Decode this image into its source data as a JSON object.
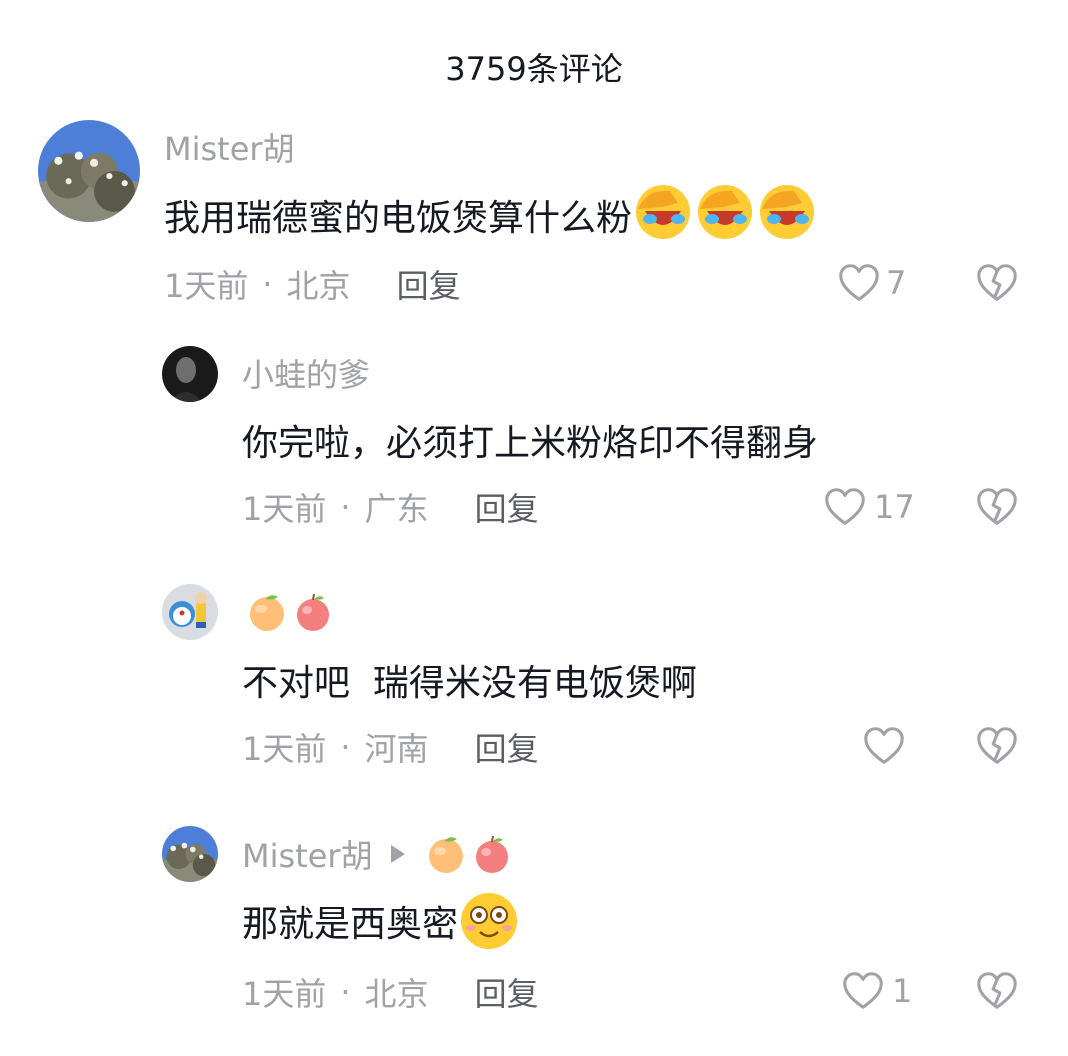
{
  "header": {
    "title": "3759条评论"
  },
  "comments": [
    {
      "name": "Mister胡",
      "text": "我用瑞德蜜的电饭煲算什么粉",
      "emoji": "facepalm-laugh-emoji",
      "time": "1天前",
      "location": "北京",
      "reply": "回复",
      "likes": "7"
    },
    {
      "name": "小蛙的爹",
      "text": "你完啦，必须打上米粉烙印不得翻身",
      "time": "1天前",
      "location": "广东",
      "reply": "回复",
      "likes": "17"
    },
    {
      "name": "",
      "name_emoji": [
        "peach-emoji",
        "apple-emoji"
      ],
      "text": "不对吧  瑞得米没有电饭煲啊",
      "time": "1天前",
      "location": "河南",
      "reply": "回复",
      "likes": ""
    },
    {
      "name": "Mister胡",
      "name_emoji": [
        "peach-emoji",
        "apple-emoji"
      ],
      "text": "那就是西奥密",
      "emoji": "dazed-smile-emoji",
      "time": "1天前",
      "location": "北京",
      "reply": "回复",
      "likes": "1"
    }
  ],
  "colors": {
    "secondary_text": "#a0a2a8",
    "reply_text": "#5c5e66",
    "primary_text": "#161823"
  }
}
